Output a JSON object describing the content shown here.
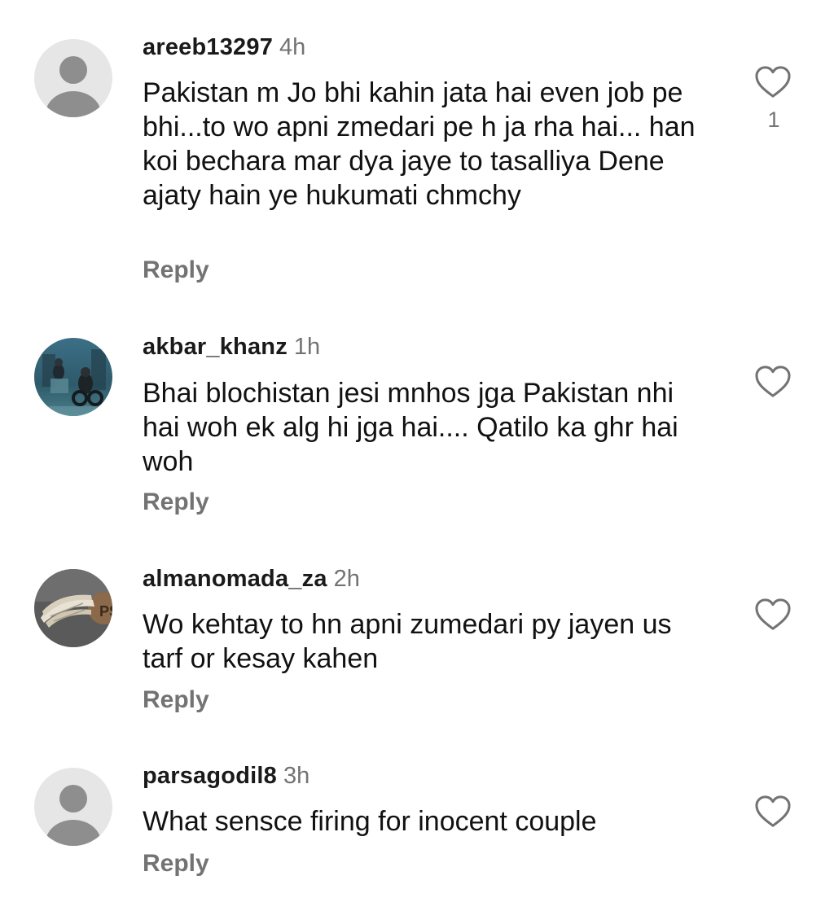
{
  "comments": [
    {
      "username": "areeb13297",
      "time": "4h",
      "avatar": "default-avatar",
      "text": "Pakistan m Jo bhi kahin jata hai even job pe bhi...to wo apni zmedari pe h ja rha hai... han koi bechara mar dya jaye to tasalliya Dene ajaty hain ye hukumati chmchy",
      "reply_label": "Reply",
      "like_icon": "heart-outline-icon",
      "like_count": "1"
    },
    {
      "username": "akbar_khanz",
      "time": "1h",
      "avatar": "photo-avatar-night-scene",
      "text": "Bhai blochistan jesi mnhos jga Pakistan nhi hai woh ek alg hi jga hai.... Qatilo ka ghr hai woh",
      "reply_label": "Reply",
      "like_icon": "heart-outline-icon"
    },
    {
      "username": "almanomada_za",
      "time": "2h",
      "avatar": "photo-avatar-wings-badge",
      "text": "Wo kehtay to hn apni zumedari py jayen us tarf or kesay kahen",
      "reply_label": "Reply",
      "like_icon": "heart-outline-icon"
    },
    {
      "username": "parsagodil8",
      "time": "3h",
      "avatar": "default-avatar",
      "text": "What sensce firing for inocent couple",
      "reply_label": "Reply",
      "like_icon": "heart-outline-icon"
    }
  ],
  "colors": {
    "username": "#1a1a1a",
    "secondary_text": "#737373",
    "default_avatar_bg": "#e6e6e6",
    "default_avatar_fg": "#8e8e8e"
  }
}
